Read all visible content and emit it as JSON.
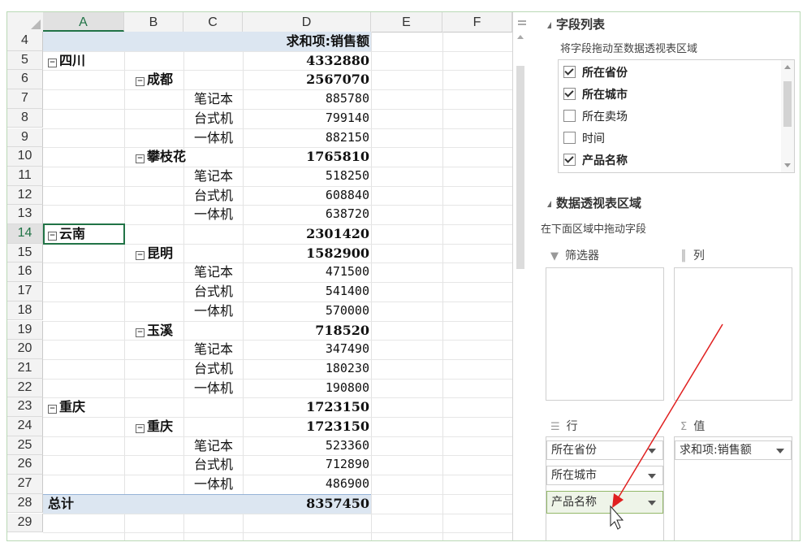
{
  "sheet": {
    "columns": [
      "A",
      "B",
      "C",
      "D",
      "E",
      "F"
    ],
    "selected_column": "A",
    "selected_row": "14",
    "header_row": {
      "row": "4",
      "value_label": "求和项:销售额"
    },
    "rows": [
      {
        "row": "5",
        "a": "四川",
        "toggle": true,
        "value": "4332880",
        "bold": true
      },
      {
        "row": "6",
        "b": "成都",
        "toggle": true,
        "value": "2567070",
        "bold": true
      },
      {
        "row": "7",
        "c": "笔记本",
        "value": "885780"
      },
      {
        "row": "8",
        "c": "台式机",
        "value": "799140"
      },
      {
        "row": "9",
        "c": "一体机",
        "value": "882150"
      },
      {
        "row": "10",
        "b": "攀枝花",
        "toggle": true,
        "value": "1765810",
        "bold": true
      },
      {
        "row": "11",
        "c": "笔记本",
        "value": "518250"
      },
      {
        "row": "12",
        "c": "台式机",
        "value": "608840"
      },
      {
        "row": "13",
        "c": "一体机",
        "value": "638720"
      },
      {
        "row": "14",
        "a": "云南",
        "toggle": true,
        "value": "2301420",
        "bold": true
      },
      {
        "row": "15",
        "b": "昆明",
        "toggle": true,
        "value": "1582900",
        "bold": true
      },
      {
        "row": "16",
        "c": "笔记本",
        "value": "471500"
      },
      {
        "row": "17",
        "c": "台式机",
        "value": "541400"
      },
      {
        "row": "18",
        "c": "一体机",
        "value": "570000"
      },
      {
        "row": "19",
        "b": "玉溪",
        "toggle": true,
        "value": "718520",
        "bold": true
      },
      {
        "row": "20",
        "c": "笔记本",
        "value": "347490"
      },
      {
        "row": "21",
        "c": "台式机",
        "value": "180230"
      },
      {
        "row": "22",
        "c": "一体机",
        "value": "190800"
      },
      {
        "row": "23",
        "a": "重庆",
        "toggle": true,
        "value": "1723150",
        "bold": true
      },
      {
        "row": "24",
        "b": "重庆",
        "toggle": true,
        "value": "1723150",
        "bold": true
      },
      {
        "row": "25",
        "c": "笔记本",
        "value": "523360"
      },
      {
        "row": "26",
        "c": "台式机",
        "value": "712890"
      },
      {
        "row": "27",
        "c": "一体机",
        "value": "486900"
      },
      {
        "row": "28",
        "a": "总计",
        "value": "8357450",
        "bold": true,
        "total": true
      },
      {
        "row": "29"
      }
    ],
    "toggle_glyph": "−"
  },
  "pane": {
    "field_list_title": "字段列表",
    "field_list_hint": "将字段拖动至数据透视表区域",
    "fields": [
      {
        "label": "所在省份",
        "checked": true
      },
      {
        "label": "所在城市",
        "checked": true
      },
      {
        "label": "所在卖场",
        "checked": false
      },
      {
        "label": "时间",
        "checked": false
      },
      {
        "label": "产品名称",
        "checked": true
      }
    ],
    "areas_title": "数据透视表区域",
    "areas_hint": "在下面区域中拖动字段",
    "filter_label": "筛选器",
    "columns_label": "列",
    "rows_label": "行",
    "values_label": "值",
    "row_fields": [
      "所在省份",
      "所在城市",
      "产品名称"
    ],
    "value_fields": [
      "求和项:销售额"
    ],
    "icons": {
      "filter": "funnel-icon",
      "columns": "columns-icon",
      "rows": "rows-icon",
      "values": "sigma-icon"
    },
    "arrow_color": "#e02020"
  }
}
